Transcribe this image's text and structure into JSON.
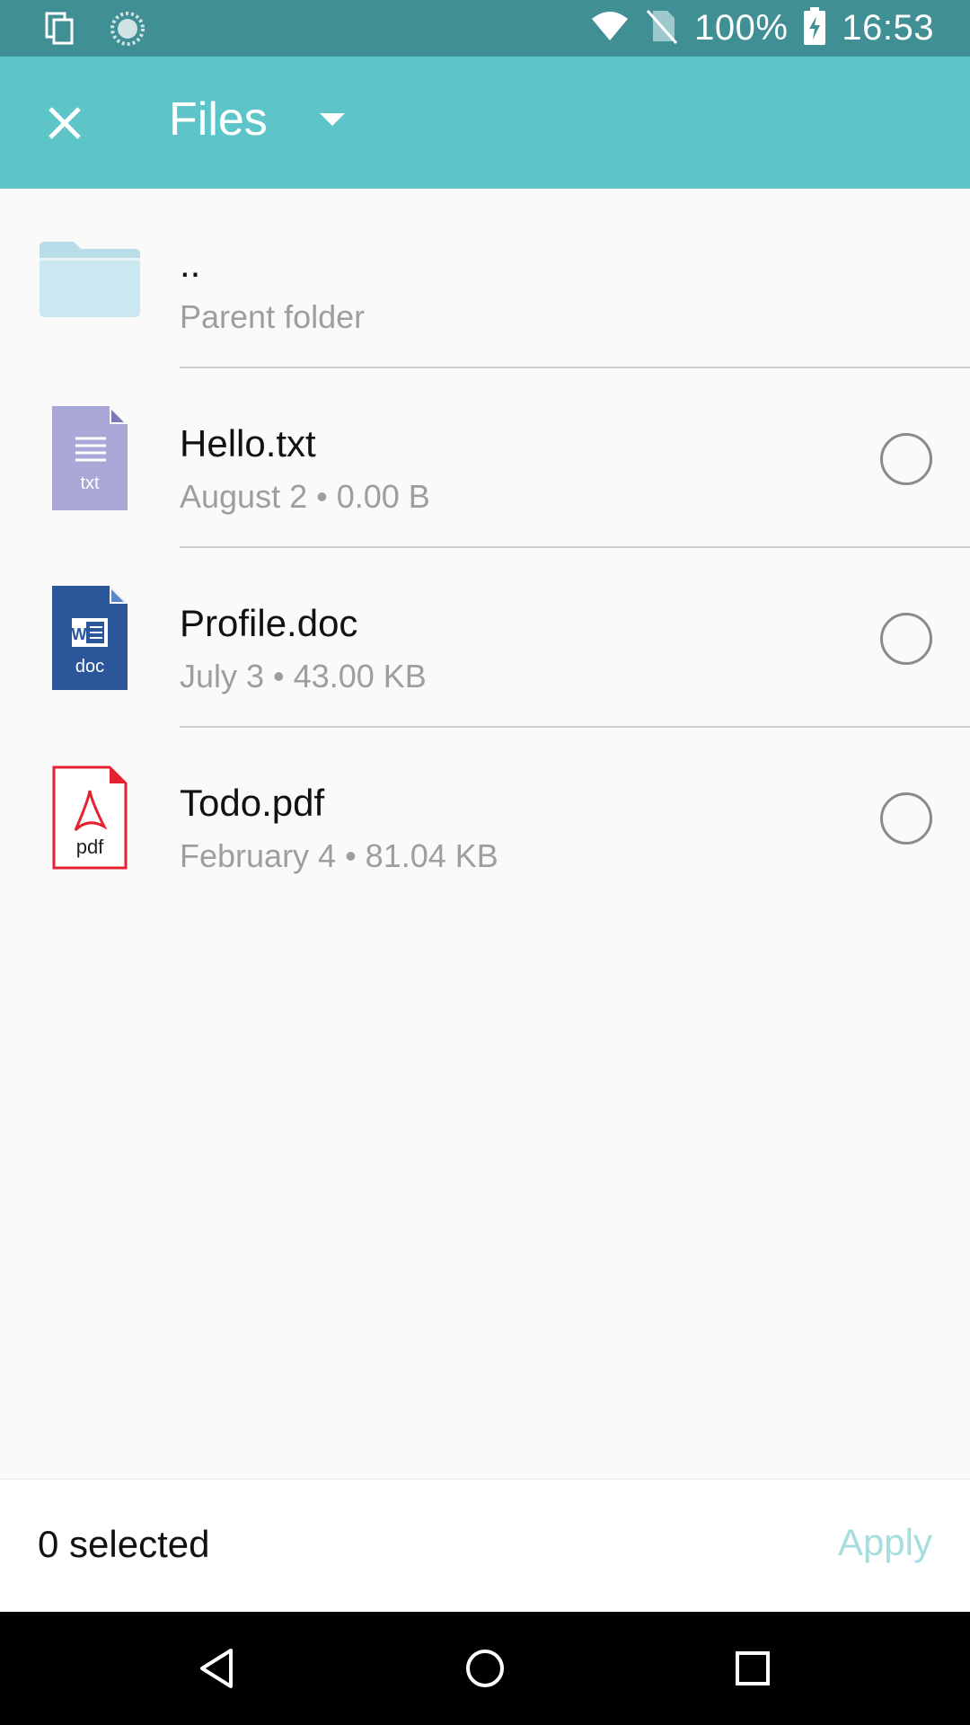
{
  "status_bar": {
    "battery": "100%",
    "time": "16:53",
    "icons": [
      "copy-icon",
      "sync-icon",
      "wifi-icon",
      "no-sim-icon",
      "battery-charging-icon"
    ]
  },
  "app_bar": {
    "title": "Files",
    "close_icon": "close-icon",
    "dropdown_icon": "dropdown-icon",
    "background": "#5dc5c8"
  },
  "files": [
    {
      "name": "..",
      "meta": "Parent folder",
      "icon": "folder-icon"
    },
    {
      "name": "Hello.txt",
      "meta": "August 2 • 0.00 B",
      "icon": "txt-file-icon",
      "icon_label": "txt"
    },
    {
      "name": "Profile.doc",
      "meta": "July 3 • 43.00 KB",
      "icon": "doc-file-icon",
      "icon_label": "doc"
    },
    {
      "name": "Todo.pdf",
      "meta": "February 4 • 81.04 KB",
      "icon": "pdf-file-icon",
      "icon_label": "pdf"
    }
  ],
  "bottom_bar": {
    "selected": "0 selected",
    "apply": "Apply"
  },
  "nav_bar": {
    "back": "back-icon",
    "home": "home-icon",
    "recents": "recents-icon"
  },
  "colors": {
    "status_bar": "#3f8f95",
    "accent": "#5dc5c8",
    "apply_disabled": "#a5dde0",
    "txt_icon": "#a9a8d6",
    "doc_icon": "#2b579a",
    "pdf_icon": "#e52230"
  }
}
